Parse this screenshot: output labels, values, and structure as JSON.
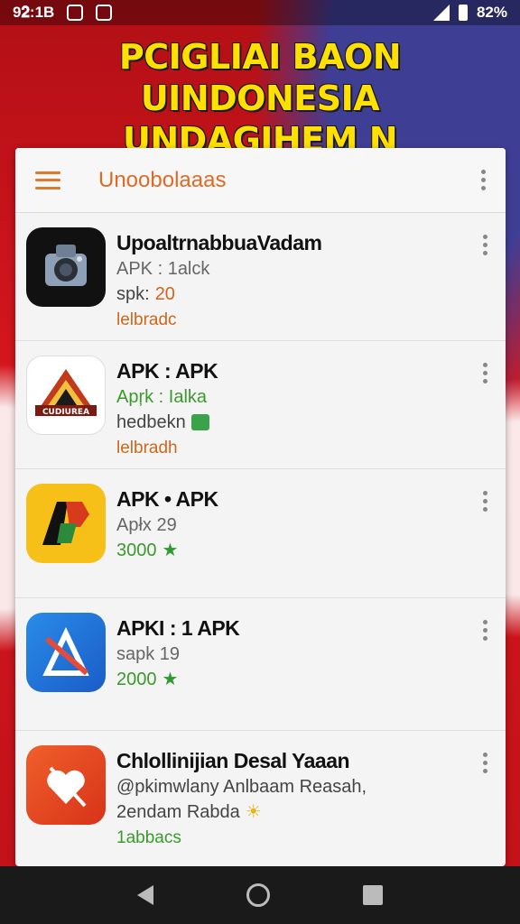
{
  "status_bar": {
    "time": "9𝟐:1B",
    "battery": "82%"
  },
  "banner": {
    "line1": "PCIGLIAI BAON UINDONESIA",
    "line2": "UNDAGIHEM N IIIPUAOAIAU!"
  },
  "toolbar": {
    "title": "Unoobolaaas"
  },
  "apps": [
    {
      "name": "UpoaltrnabbuaVadam",
      "sub": "APK : 1alck",
      "line3_label": "spk:",
      "line3_value": "20",
      "tag": "lelbradc",
      "icon": "camera-icon"
    },
    {
      "name": "APK : APK",
      "sub": "Apŗk : Ialka",
      "line3_label": "hedbekn",
      "line3_value": "",
      "tag": "lelbradh",
      "icon": "mountain-logo-icon"
    },
    {
      "name": "APK • APK",
      "sub": "Apłx 29",
      "line3_label": "",
      "line3_value": "3000",
      "tag": "",
      "icon": "ap-logo-icon"
    },
    {
      "name": "APKI : 1 APK",
      "sub": "sapk 19",
      "line3_label": "",
      "line3_value": "2000",
      "tag": "",
      "icon": "blue-triangle-icon"
    },
    {
      "name": "Chlollinijian Desal Yaaan",
      "sub": "@pkimwlany Anlbaam Reasah,",
      "line3_label": "2endam Rabda",
      "line3_value": "",
      "tag": "1abbacs",
      "icon": "heart-tool-icon"
    }
  ],
  "colors": {
    "accent": "#e06a24",
    "green": "#3a9a2c",
    "background_red": "#c8141c"
  }
}
